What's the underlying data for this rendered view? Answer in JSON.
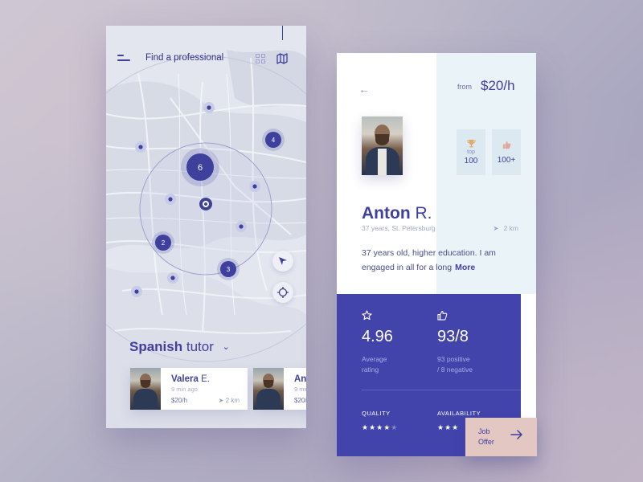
{
  "left_phone": {
    "title": "Find a professional",
    "icons": {
      "menu": "hamburger-icon",
      "grid": "grid-icon",
      "map": "map-icon",
      "locate": "navigation-arrow-icon",
      "target": "crosshair-icon"
    },
    "clusters": [
      {
        "label": "6"
      },
      {
        "label": "4"
      },
      {
        "label": "2"
      },
      {
        "label": "3"
      }
    ],
    "heading": {
      "bold": "Spanish",
      "rest": "tutor"
    },
    "cards": [
      {
        "name_bold": "Valera",
        "name_rest": "E.",
        "ago": "9 min ago",
        "price": "$20/h",
        "distance": "2 km"
      },
      {
        "name_bold": "An",
        "name_rest": "",
        "ago": "9 min",
        "price": "$20/"
      }
    ]
  },
  "right_phone": {
    "from_label": "from",
    "price": "$20/h",
    "badges": [
      {
        "icon": "trophy-icon",
        "small": "top",
        "value": "100"
      },
      {
        "icon": "thumbs-up-icon",
        "small": "",
        "value": "100+"
      }
    ],
    "profile": {
      "first": "Anton",
      "last": "R.",
      "meta": "37 years, St. Petersburg",
      "distance": "2 km",
      "bio": "37 years old, higher education. I am engaged in all for a long",
      "more": "More"
    },
    "stats": {
      "rating": {
        "value": "4.96",
        "label_line1": "Average",
        "label_line2": "rating"
      },
      "reviews": {
        "value": "93/8",
        "label_line1": "93 positive",
        "label_line2": "/ 8 negative"
      },
      "quality_label": "QUALITY",
      "quality_stars": 4,
      "availability_label": "AVAILABILITY",
      "availability_stars": 3
    },
    "job_button": {
      "line1": "Job",
      "line2": "Offer"
    }
  },
  "colors": {
    "primary": "#3f3f9e",
    "stats_bg": "#4244ac",
    "accent": "#e3c7c2",
    "map_bg": "#e3e6ef"
  }
}
